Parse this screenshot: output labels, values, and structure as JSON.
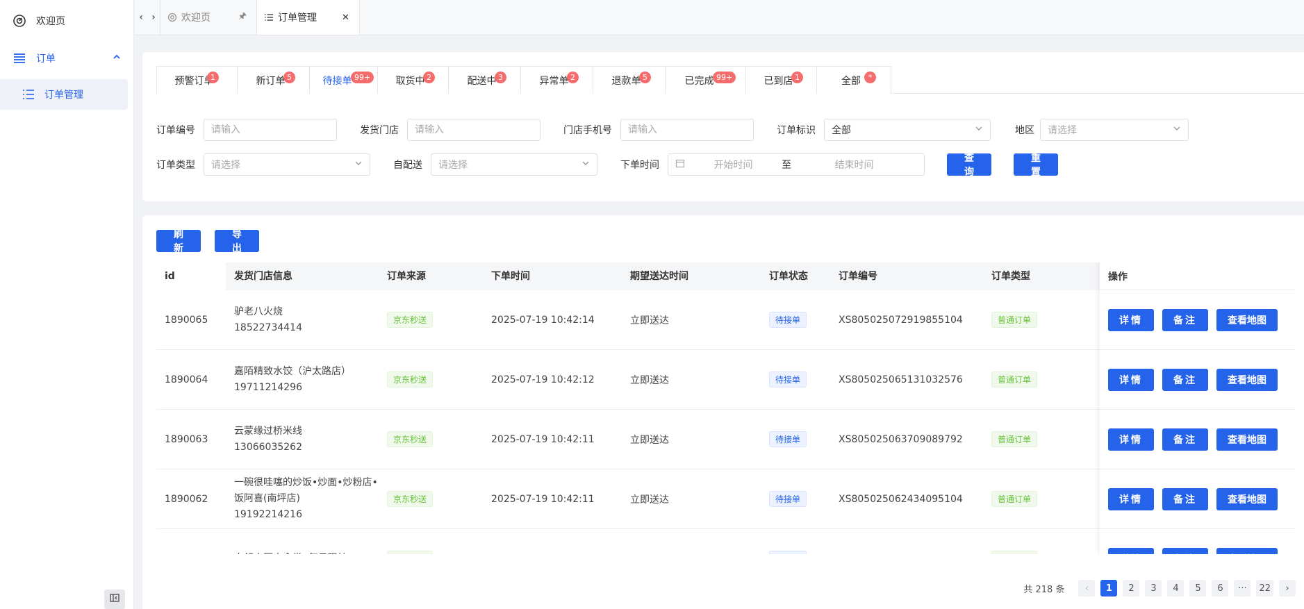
{
  "sidebar": {
    "welcome": "欢迎页",
    "group": "订单",
    "sub": "订单管理"
  },
  "pagetabs": {
    "tab1": "欢迎页",
    "tab2": "订单管理"
  },
  "status_tabs": [
    {
      "label": "预警订单",
      "badge": "1"
    },
    {
      "label": "新订单",
      "badge": "5"
    },
    {
      "label": "待接单",
      "badge": "99+"
    },
    {
      "label": "取货中",
      "badge": "2"
    },
    {
      "label": "配送中",
      "badge": "3"
    },
    {
      "label": "异常单",
      "badge": "2"
    },
    {
      "label": "退款单",
      "badge": "5"
    },
    {
      "label": "已完成",
      "badge": "99+"
    },
    {
      "label": "已到店",
      "badge": "1"
    },
    {
      "label": "全部",
      "badge": "*"
    }
  ],
  "filters": {
    "order_no_label": "订单编号",
    "order_no_ph": "请输入",
    "store_label": "发货门店",
    "store_ph": "请输入",
    "phone_label": "门店手机号",
    "phone_ph": "请输入",
    "flag_label": "订单标识",
    "flag_value": "全部",
    "region_label": "地区",
    "region_ph": "请选择",
    "type_label": "订单类型",
    "type_ph": "请选择",
    "self_label": "自配送",
    "self_ph": "请选择",
    "time_label": "下单时间",
    "time_start": "开始时间",
    "time_sep": "至",
    "time_end": "结束时间",
    "query_btn": "查询",
    "reset_btn": "重置"
  },
  "table_actions": {
    "refresh": "刷新",
    "export": "导出"
  },
  "table": {
    "headers": [
      "id",
      "发货门店信息",
      "订单来源",
      "下单时间",
      "期望送达时间",
      "订单状态",
      "订单编号",
      "订单类型"
    ],
    "op_header": "操作",
    "rows": [
      {
        "id": "1890065",
        "store_name": "驴老八火烧",
        "store_phone": "18522734414",
        "source": "京东秒送",
        "time": "2025-07-19 10:42:14",
        "expect": "立即送达",
        "status": "待接单",
        "order_no": "XS805025072919855104",
        "type": "普通订单"
      },
      {
        "id": "1890064",
        "store_name": "嘉陌精致水饺（沪太路店）",
        "store_phone": "19711214296",
        "source": "京东秒送",
        "time": "2025-07-19 10:42:12",
        "expect": "立即送达",
        "status": "待接单",
        "order_no": "XS805025065131032576",
        "type": "普通订单"
      },
      {
        "id": "1890063",
        "store_name": "云蒙缘过桥米线",
        "store_phone": "13066035262",
        "source": "京东秒送",
        "time": "2025-07-19 10:42:11",
        "expect": "立即送达",
        "status": "待接单",
        "order_no": "XS805025063709089792",
        "type": "普通订单"
      },
      {
        "id": "1890062",
        "store_name": "一碗很哇噻的炒饭•炒面•炒粉店•饭阿喜(南坪店)",
        "store_phone": "19192214216",
        "source": "京东秒送",
        "time": "2025-07-19 10:42:11",
        "expect": "立即送达",
        "status": "待接单",
        "order_no": "XS805025062434095104",
        "type": "普通订单"
      },
      {
        "id": "",
        "store_name": "白领小厨大食堂· 每日现炒",
        "store_phone": "",
        "source": "京东秒送",
        "time": "",
        "expect": "",
        "status": "待接单",
        "order_no": "",
        "type": "普通订单"
      }
    ],
    "op_detail": "详情",
    "op_note": "备注",
    "op_map": "查看地图"
  },
  "pager": {
    "total": "共 218 条",
    "pages": [
      "1",
      "2",
      "3",
      "4",
      "5",
      "6",
      "···",
      "22"
    ],
    "prev": "‹",
    "next": "›"
  }
}
